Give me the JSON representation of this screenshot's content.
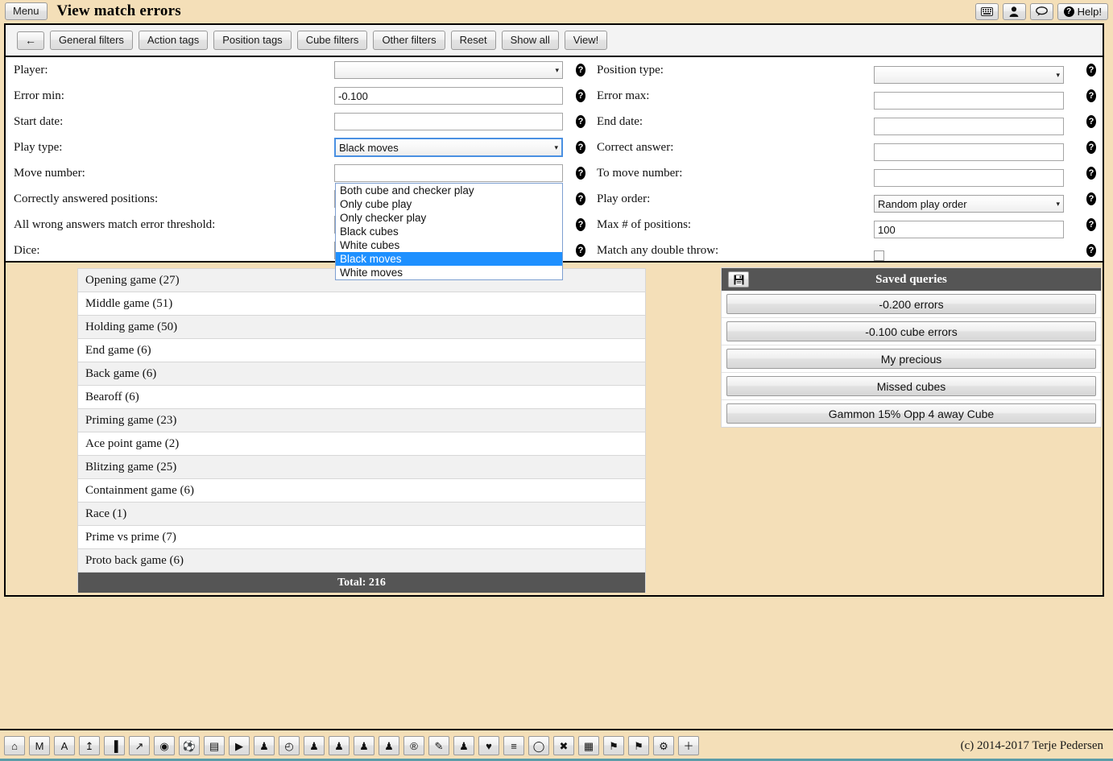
{
  "titlebar": {
    "menu_label": "Menu",
    "title": "View match errors",
    "buttons": [
      {
        "name": "keyboard-icon",
        "glyph": "⌨"
      },
      {
        "name": "user-icon",
        "glyph": "♟"
      },
      {
        "name": "comment-icon",
        "glyph": "◯"
      }
    ],
    "help_label": "Help!",
    "help_mark": "?"
  },
  "toolbar": {
    "back_glyph": "←",
    "buttons": [
      "General filters",
      "Action tags",
      "Position tags",
      "Cube filters",
      "Other filters",
      "Reset",
      "Show all",
      "View!"
    ]
  },
  "form": {
    "help_mark": "?",
    "left": [
      {
        "label": "Player:",
        "type": "select",
        "value": ""
      },
      {
        "label": "Error min:",
        "type": "text",
        "value": "-0.100"
      },
      {
        "label": "Start date:",
        "type": "text",
        "value": ""
      },
      {
        "label": "Play type:",
        "type": "select-open",
        "value": "Black moves"
      },
      {
        "label": "Move number:",
        "type": "text",
        "value": ""
      },
      {
        "label": "Correctly answered positions:",
        "type": "text",
        "value": ""
      },
      {
        "label": "All wrong answers match error threshold:",
        "type": "text",
        "value": ""
      },
      {
        "label": "Dice:",
        "type": "dice",
        "value": ""
      }
    ],
    "right": [
      {
        "label": "Position type:",
        "type": "select",
        "value": ""
      },
      {
        "label": "Error max:",
        "type": "text",
        "value": ""
      },
      {
        "label": "End date:",
        "type": "text",
        "value": ""
      },
      {
        "label": "Correct answer:",
        "type": "text",
        "value": ""
      },
      {
        "label": "To move number:",
        "type": "text",
        "value": ""
      },
      {
        "label": "Play order:",
        "type": "select",
        "value": "Random play order"
      },
      {
        "label": "Max # of positions:",
        "type": "text",
        "value": "100"
      },
      {
        "label": "Match any double throw:",
        "type": "checkbox",
        "value": ""
      }
    ],
    "play_type_options": [
      "Both cube and checker play",
      "Only cube play",
      "Only checker play",
      "Black cubes",
      "White cubes",
      "Black moves",
      "White moves"
    ],
    "play_type_selected": "Black moves",
    "arrow_glyph": "▾"
  },
  "gamelist": {
    "rows": [
      "Opening game (27)",
      "Middle game (51)",
      "Holding game (50)",
      "End game (6)",
      "Back game (6)",
      "Bearoff (6)",
      "Priming game (23)",
      "Ace point game (2)",
      "Blitzing game (25)",
      "Containment game (6)",
      "Race (1)",
      "Prime vs prime (7)",
      "Proto back game (6)"
    ],
    "total": "Total: 216"
  },
  "saved_queries": {
    "title": "Saved queries",
    "save_icon": "💾",
    "items": [
      "-0.200 errors",
      "-0.100 cube errors",
      "My precious",
      "Missed cubes",
      "Gammon 15% Opp 4 away Cube"
    ]
  },
  "bottombar": {
    "icons": [
      {
        "name": "home-icon",
        "glyph": "⌂"
      },
      {
        "name": "m-icon",
        "glyph": "M"
      },
      {
        "name": "a-icon",
        "glyph": "A"
      },
      {
        "name": "upload-icon",
        "glyph": "↥"
      },
      {
        "name": "bar-chart-icon",
        "glyph": "▐"
      },
      {
        "name": "line-chart-icon",
        "glyph": "↗"
      },
      {
        "name": "eye-icon",
        "glyph": "◉"
      },
      {
        "name": "ball-icon",
        "glyph": "⚽"
      },
      {
        "name": "archive-icon",
        "glyph": "▤"
      },
      {
        "name": "play-icon",
        "glyph": "▶"
      },
      {
        "name": "trophy-icon",
        "glyph": "♟"
      },
      {
        "name": "clock-icon",
        "glyph": "◴"
      },
      {
        "name": "trophy2-icon",
        "glyph": "♟"
      },
      {
        "name": "trophy3-icon",
        "glyph": "♟"
      },
      {
        "name": "trophy4-icon",
        "glyph": "♟"
      },
      {
        "name": "trophy5-icon",
        "glyph": "♟"
      },
      {
        "name": "registered-icon",
        "glyph": "®"
      },
      {
        "name": "edit-icon",
        "glyph": "✎"
      },
      {
        "name": "trophy6-icon",
        "glyph": "♟"
      },
      {
        "name": "heart-icon",
        "glyph": "♥"
      },
      {
        "name": "database-icon",
        "glyph": "≡"
      },
      {
        "name": "comment-icon",
        "glyph": "◯"
      },
      {
        "name": "close-icon",
        "glyph": "✖"
      },
      {
        "name": "film-icon",
        "glyph": "▦"
      },
      {
        "name": "bookmark-icon",
        "glyph": "⚑"
      },
      {
        "name": "bookmark2-icon",
        "glyph": "⚑"
      },
      {
        "name": "settings-icon",
        "glyph": "⚙"
      },
      {
        "name": "plus-icon",
        "glyph": "＋"
      }
    ],
    "copyright": "(c) 2014-2017 Terje Pedersen"
  }
}
